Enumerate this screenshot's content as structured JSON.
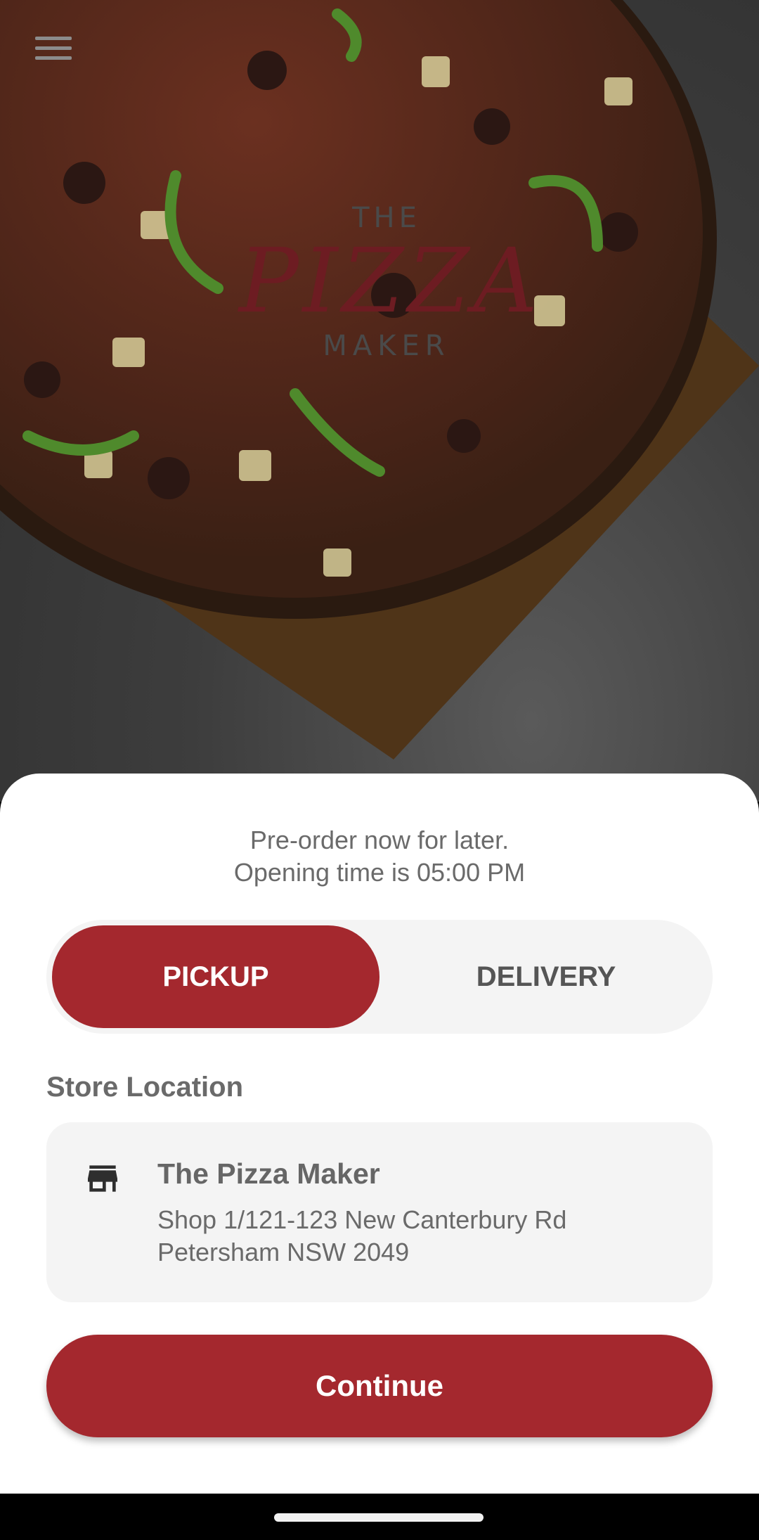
{
  "header": {
    "menu_icon": "hamburger-menu-icon"
  },
  "logo": {
    "line1": "THE",
    "line2": "PIZZA",
    "line3": "MAKER"
  },
  "notice": {
    "line1": "Pre-order now for later.",
    "line2": "Opening time is 05:00 PM"
  },
  "order_type": {
    "options": [
      "PICKUP",
      "DELIVERY"
    ],
    "selected": "PICKUP"
  },
  "store": {
    "section_label": "Store Location",
    "icon": "store-icon",
    "name": "The Pizza Maker",
    "address_line1": "Shop 1/121-123 New Canterbury Rd",
    "address_line2": "Petersham NSW 2049"
  },
  "actions": {
    "continue_label": "Continue"
  },
  "colors": {
    "accent": "#a4282e",
    "surface": "#f4f4f4",
    "text_muted": "#6a6a6a"
  }
}
